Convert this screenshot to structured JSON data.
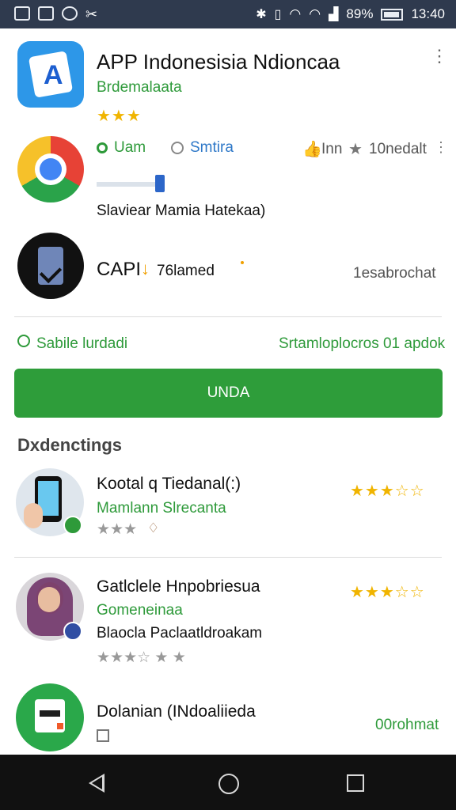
{
  "status_bar": {
    "battery": "89%",
    "time": "13:40"
  },
  "header_app": {
    "title": "APP Indonesisia Ndioncaa",
    "developer": "Brdemalaata",
    "rating": "★★★"
  },
  "chrome_row": {
    "option1": "Uam",
    "option2": "Smtira",
    "right_label": "Inn",
    "right_extra": "10nedalt",
    "caption": "Slaviear Mamia Hatekaa)"
  },
  "download_row": {
    "label": "CAPI",
    "sub": "76lamed",
    "right": "1esabrochat"
  },
  "info_row": {
    "left": "Sabile lurdadi",
    "right": "Srtamloplocros 01 apdok"
  },
  "install_button": "UNDA",
  "section_title": "Dxdenctings",
  "list": [
    {
      "title": "Kootal q Tiedanal(:)",
      "subtitle": "Mamlann Slrecanta",
      "stars_line": "★★★",
      "rating": "★★★☆☆"
    },
    {
      "title": "Gatlclele Hnpobriesua",
      "subtitle": "Gomeneinaa",
      "extra": "Blaocla Paclaatldroakam",
      "stars_line": "★★★☆ ★ ★",
      "rating": "★★★☆☆"
    },
    {
      "title": "Dolanian (INdoaliieda",
      "right": "00rohmat"
    }
  ]
}
